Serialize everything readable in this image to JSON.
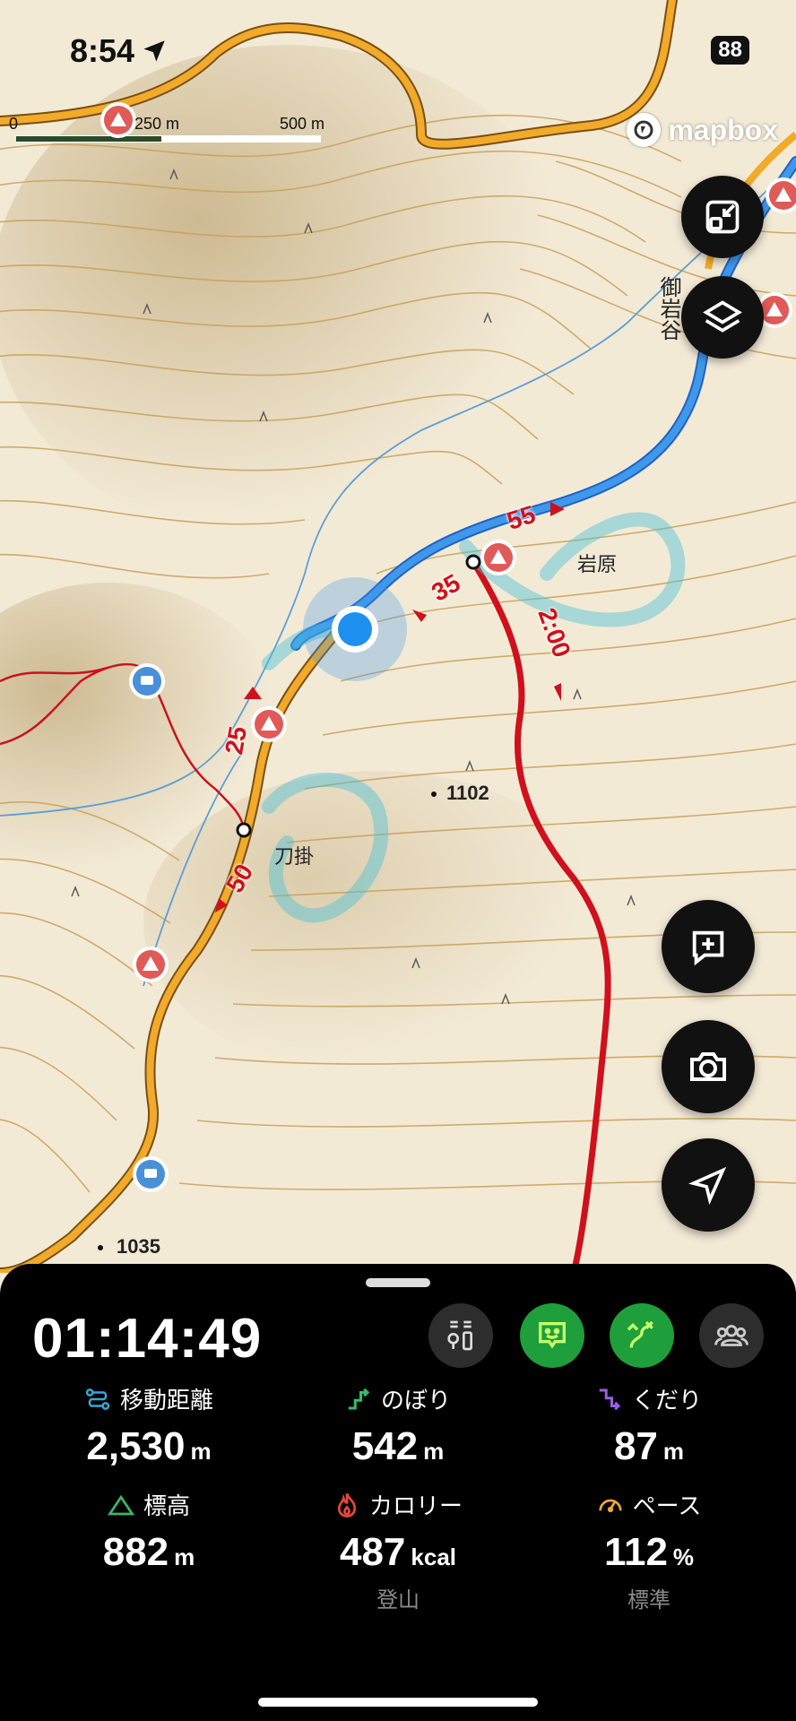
{
  "status": {
    "time": "8:54",
    "battery": "88"
  },
  "map": {
    "scale": {
      "zero": "0",
      "mid": "250 m",
      "end": "500 m"
    },
    "attribution": "mapbox",
    "labels": {
      "valley": "御岩谷",
      "place_iwahara": "岩原",
      "place_tougake": "刀掛",
      "peak_1102": "1102",
      "peak_1035": "1035"
    },
    "route_times": {
      "t55": "55",
      "t35": "35",
      "t25": "25",
      "t50": "50",
      "t200": "2:00"
    }
  },
  "controls": {
    "collapse": "collapse-icon",
    "layers": "layers-icon",
    "add_note": "add-note-icon",
    "camera": "camera-icon",
    "locate": "locate-arrow-icon"
  },
  "panel": {
    "elapsed": "01:14:49",
    "stats": [
      {
        "label": "移動距離",
        "value": "2,530",
        "unit": "m",
        "sub": ""
      },
      {
        "label": "のぼり",
        "value": "542",
        "unit": "m",
        "sub": ""
      },
      {
        "label": "くだり",
        "value": "87",
        "unit": "m",
        "sub": ""
      },
      {
        "label": "標高",
        "value": "882",
        "unit": "m",
        "sub": ""
      },
      {
        "label": "カロリー",
        "value": "487",
        "unit": "kcal",
        "sub": "登山"
      },
      {
        "label": "ペース",
        "value": "112",
        "unit": "%",
        "sub": "標準"
      }
    ],
    "colors": {
      "distance": "#3aa7d6",
      "up": "#2fbf6a",
      "down": "#9b5de5",
      "elev": "#3fb46a",
      "cal": "#e5463c",
      "pace": "#f0a63a",
      "accent_green": "#1f9e3c"
    }
  }
}
